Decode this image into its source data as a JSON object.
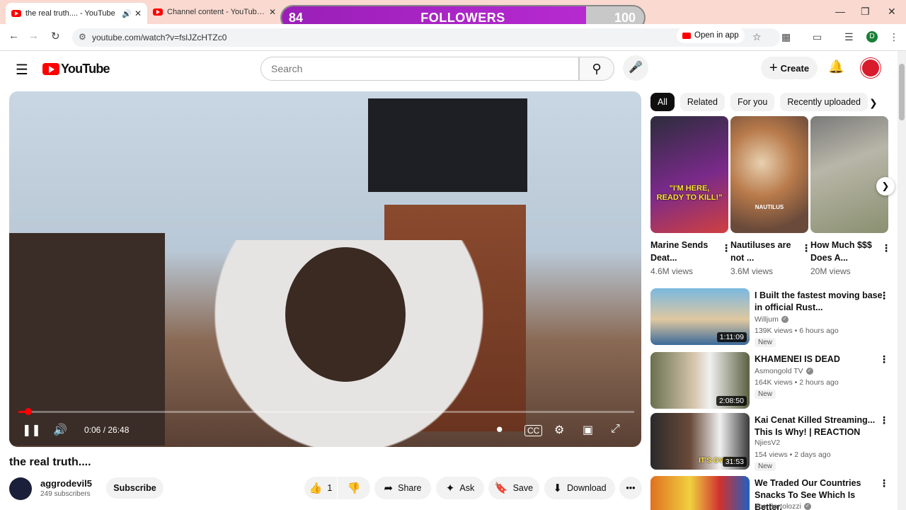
{
  "browser": {
    "tabs": [
      {
        "title": "the real truth.... - YouTube",
        "active": true
      },
      {
        "title": "Channel content - YouTube Stu",
        "active": false
      }
    ],
    "url": "youtube.com/watch?v=fslJZcHTZc0",
    "open_in_app": "Open in app",
    "profile_initial": "D"
  },
  "overlay": {
    "current": "84",
    "label": "FOLLOWERS",
    "goal": "100",
    "progress_fraction": 0.84
  },
  "header": {
    "logo": "YouTube",
    "search_placeholder": "Search",
    "create_label": "Create"
  },
  "player": {
    "time": "0:06 / 26:48",
    "progress_fraction": 0.004
  },
  "video": {
    "title": "the real truth....",
    "channel": "aggrodevil5",
    "subscribers": "249 subscribers",
    "subscribe_label": "Subscribe",
    "like_count": "1",
    "share_label": "Share",
    "ask_label": "Ask",
    "save_label": "Save",
    "download_label": "Download"
  },
  "chips": [
    "All",
    "Related",
    "For you",
    "Recently uploaded"
  ],
  "shorts": [
    {
      "title": "Marine Sends Deat...",
      "views": "4.6M views",
      "overlay_text": "\"I'M HERE, READY TO KILL!\""
    },
    {
      "title": "Nautiluses are not ...",
      "views": "3.6M views",
      "overlay_text": "NAUTILUS"
    },
    {
      "title": "How Much $$$ Does A...",
      "views": "20M views",
      "overlay_text": ""
    }
  ],
  "recommended": [
    {
      "title": "I Built the fastest moving base in official Rust...",
      "channel": "Willjum",
      "meta": "139K views • 6 hours ago",
      "badge": "New",
      "duration": "1:11:09",
      "verified": true
    },
    {
      "title": "KHAMENEI IS DEAD",
      "channel": "Asmongold TV",
      "meta": "164K views • 2 hours ago",
      "badge": "New",
      "duration": "2:08:50",
      "verified": true
    },
    {
      "title": "Kai Cenat Killed Streaming... This Is Why! | REACTION",
      "channel": "NjiesV2",
      "meta": "154 views • 2 days ago",
      "badge": "New",
      "duration": "31:53",
      "overlay_text": "IT'S OVER",
      "verified": false
    },
    {
      "title": "We Traded Our Countries Snacks To See Which Is Better.",
      "channel": "Joe Bartolozzi",
      "meta": "",
      "badge": "",
      "duration": "",
      "verified": true
    }
  ]
}
